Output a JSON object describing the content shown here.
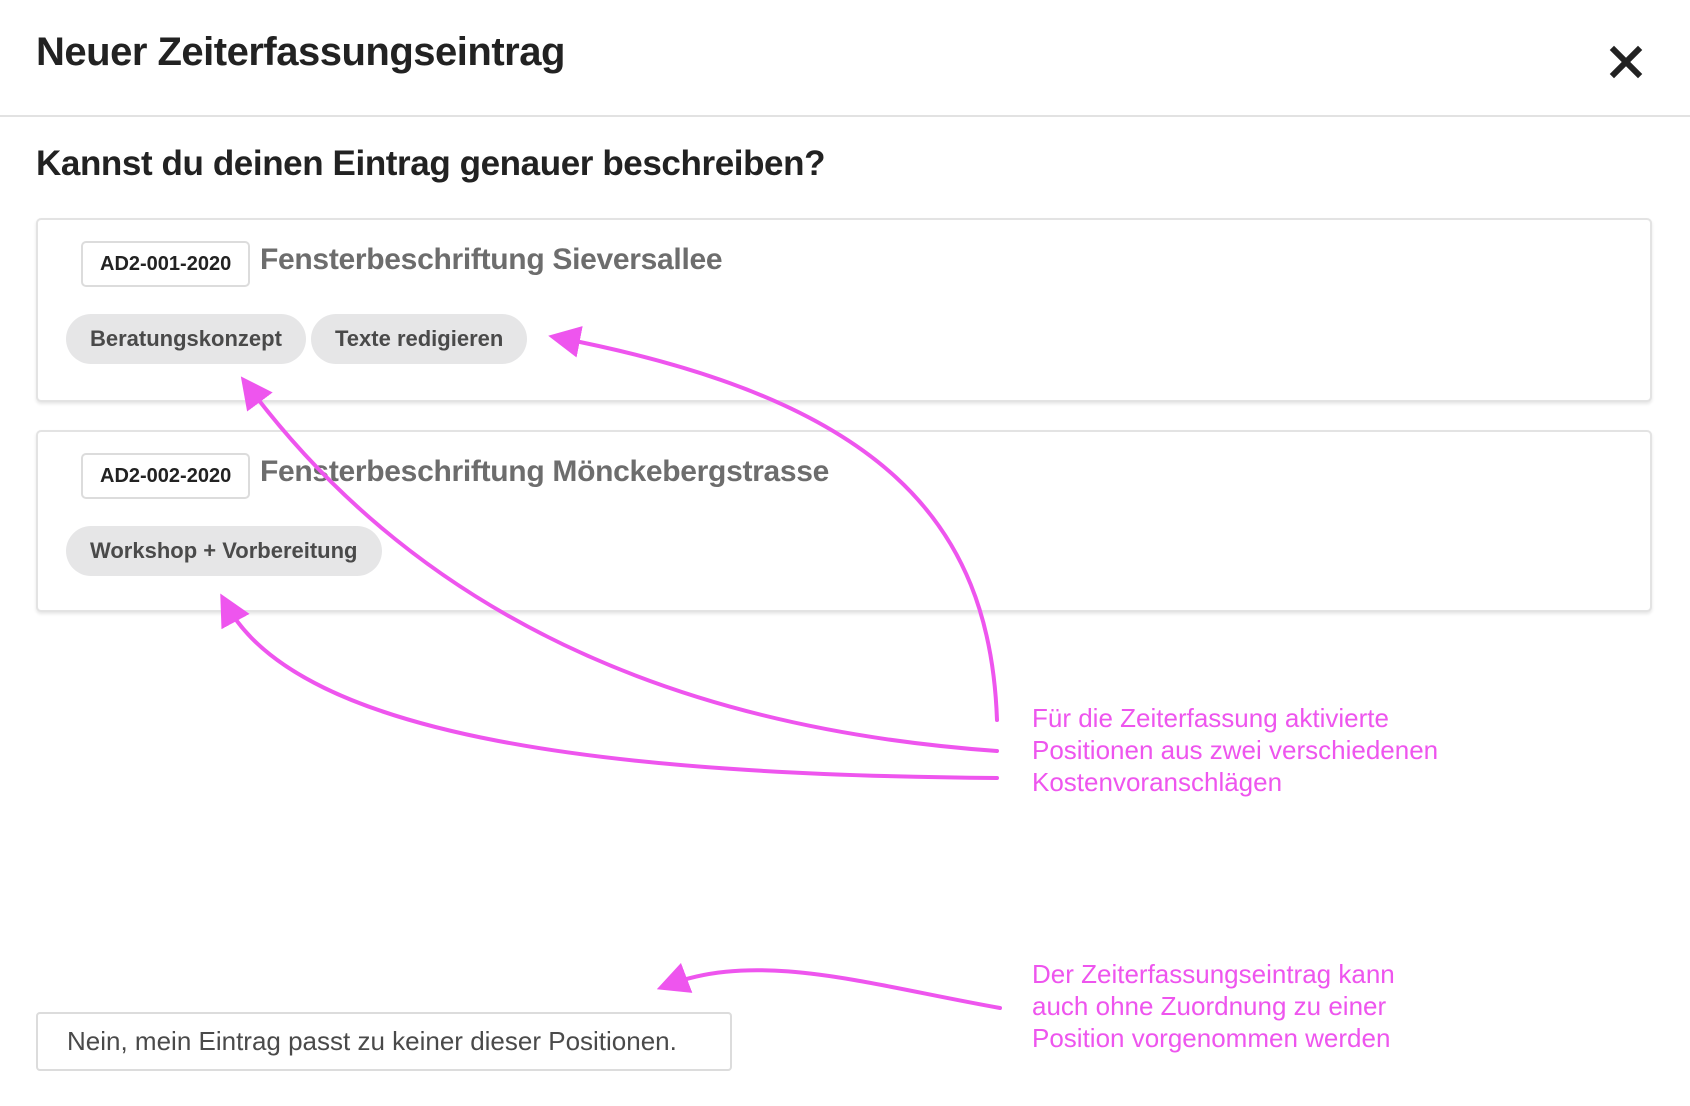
{
  "modal": {
    "title": "Neuer Zeiterfassungseintrag",
    "close_icon": "close-icon"
  },
  "question": "Kannst du deinen Eintrag genauer beschreiben?",
  "cards": [
    {
      "code": "AD2-001-2020",
      "title": "Fensterbeschriftung Sieversallee",
      "positions": [
        "Beratungskonzept",
        "Texte redigieren"
      ]
    },
    {
      "code": "AD2-002-2020",
      "title": "Fensterbeschriftung Mönckebergstrasse",
      "positions": [
        "Workshop + Vorbereitung"
      ]
    }
  ],
  "none_option": "Nein, mein Eintrag passt zu keiner dieser Positionen.",
  "annotations": {
    "color": "#ee55ee",
    "positions_note": [
      "Für die Zeiterfassung aktivierte",
      "Positionen aus zwei verschiedenen",
      "Kostenvoranschlägen"
    ],
    "no_assignment_note": [
      "Der Zeiterfassungseintrag kann",
      "auch ohne Zuordnung zu einer",
      "Position vorgenommen werden"
    ]
  }
}
